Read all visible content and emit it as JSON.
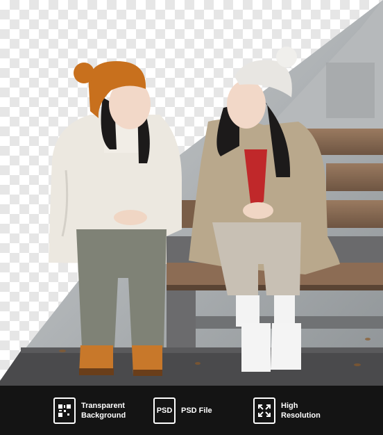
{
  "photo": {
    "description_icons": [
      "woman-left",
      "woman-right",
      "bench"
    ],
    "colors": {
      "orange_hat": "#c8701d",
      "white_hat": "#e8e6e2",
      "left_jacket": "#ece8e0",
      "right_coat": "#b9a88c",
      "left_pants": "#7f8276",
      "right_pants": "#c8c0b4",
      "bench_wood": "#8a6a52",
      "ground": "#4a4a4c"
    }
  },
  "banner": {
    "items": [
      {
        "icon": "qr-icon",
        "label_line1": "Transparent",
        "label_line2": "Background"
      },
      {
        "icon": "psd-icon",
        "icon_text": "PSD",
        "label": "PSD File"
      },
      {
        "icon": "expand-icon",
        "label_line1": "High",
        "label_line2": "Resolution"
      }
    ]
  }
}
